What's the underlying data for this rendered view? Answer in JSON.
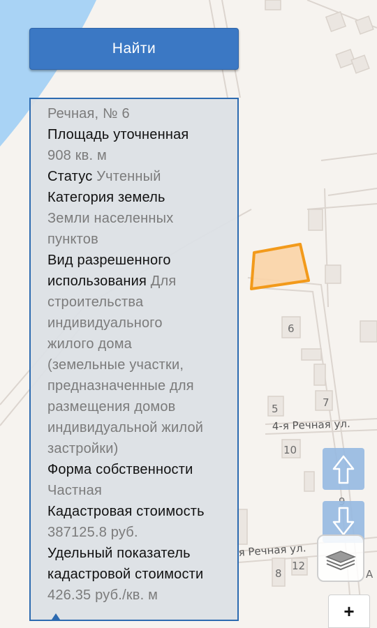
{
  "search": {
    "button_label": "Найти"
  },
  "parcel_info": {
    "address_tail": "Речная, № 6",
    "area_label": "Площадь уточненная",
    "area_value": "908 кв. м",
    "status_label": "Статус",
    "status_value": "Учтенный",
    "category_label": "Категория земель",
    "category_value_lines": [
      "Земли населенных",
      "пунктов"
    ],
    "permitted_use_label_lines": [
      "Вид разрешенного",
      "использования"
    ],
    "permitted_use_value_first": "Для",
    "permitted_use_value_lines": [
      "строительства",
      "индивидуального",
      "жилого дома",
      "(земельные участки,",
      "предназначенные для",
      "размещения домов",
      "индивидуальной жилой",
      "застройки)"
    ],
    "ownership_label": "Форма собственности",
    "ownership_value": "Частная",
    "cadastral_value_label": "Кадастровая стоимость",
    "cadastral_value": "387125.8 руб.",
    "specific_value_label_lines": [
      "Удельный показатель",
      "кадастровой стоимости"
    ],
    "specific_value": "426.35 руб./кв. м"
  },
  "map": {
    "water_color": "#a9d3f5",
    "parcel_fill": "#fbd4a6",
    "parcel_stroke": "#f29a1b",
    "house_numbers": [
      "6",
      "7",
      "5",
      "10",
      "9",
      "8",
      "12"
    ],
    "streets": {
      "fourth_rechnaya": "4-я Речная ул.",
      "rechnaya_partial": "я Речная ул."
    },
    "edge_letter": "А"
  },
  "controls": {
    "up_icon": "arrow-up-icon",
    "down_icon": "arrow-down-icon",
    "layers_icon": "layers-icon",
    "zoom_in_label": "+"
  }
}
